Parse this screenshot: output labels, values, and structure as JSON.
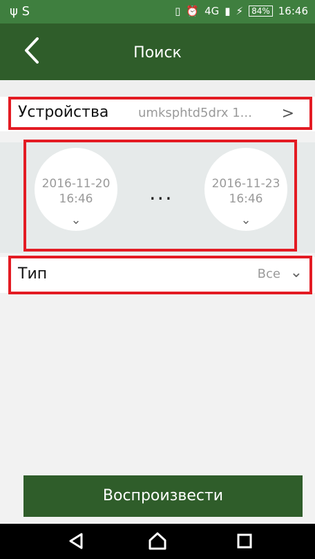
{
  "status_bar": {
    "time": "16:46",
    "battery": "84%",
    "network": "4G"
  },
  "header": {
    "title": "Поиск"
  },
  "devices_row": {
    "label": "Устройства",
    "value": "umksphtd5drx 1..."
  },
  "date_range": {
    "start_date": "2016-11-20",
    "start_time": "16:46",
    "end_date": "2016-11-23",
    "end_time": "16:46",
    "separator": "..."
  },
  "type_row": {
    "label": "Тип",
    "value": "Все"
  },
  "footer": {
    "play_button": "Воспроизвести"
  },
  "icons": {
    "back": "back-arrow-icon",
    "chevron_right": "chevron-right-icon",
    "chevron_down": "chevron-down-icon",
    "nav_back": "nav-back-icon",
    "nav_home": "nav-home-icon",
    "nav_recent": "nav-recent-icon"
  },
  "colors": {
    "header_green": "#2f5d2a",
    "status_green": "#3f7f3f",
    "highlight_red": "#e31b23"
  }
}
